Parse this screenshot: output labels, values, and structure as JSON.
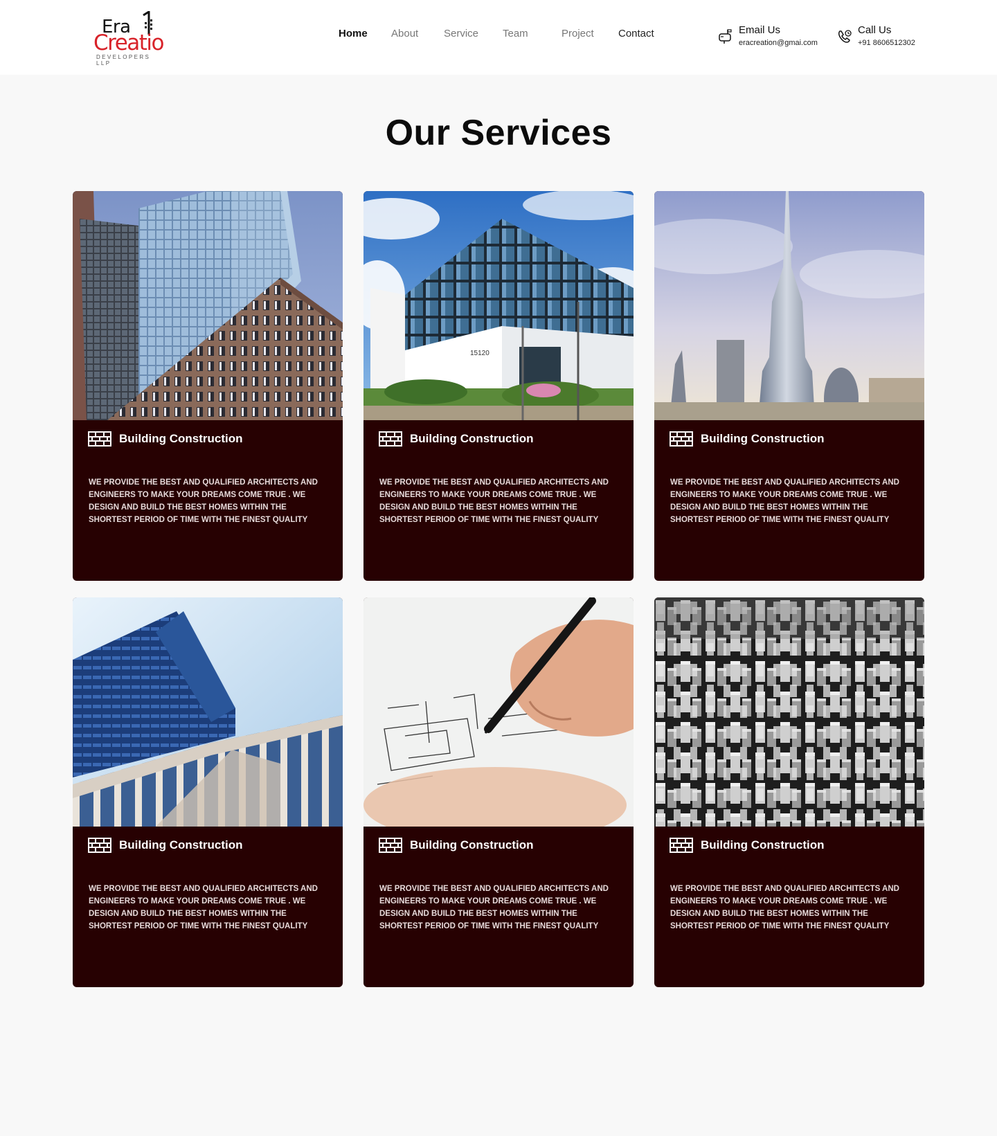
{
  "brand": {
    "line1": "Era",
    "line2": "Creatio",
    "tagline": "DEVELOPERS LLP",
    "accent_color": "#d8232a"
  },
  "nav": {
    "items": [
      {
        "label": "Home",
        "active": true
      },
      {
        "label": "About",
        "active": false
      },
      {
        "label": "Service",
        "active": false
      },
      {
        "label": "Team",
        "active": false
      },
      {
        "label": "Project",
        "active": false
      },
      {
        "label": "Contact",
        "active": false
      }
    ]
  },
  "contact": {
    "email": {
      "title": "Email Us",
      "value": "eracreation@gmai.com",
      "icon": "mailbox-icon"
    },
    "phone": {
      "title": "Call Us",
      "value": "+91 8606512302",
      "icon": "phone-icon"
    }
  },
  "services": {
    "heading": "Our Services",
    "card_color": "#270102",
    "cards": [
      {
        "image": "glass-skyscrapers-photo",
        "icon": "brick-wall-icon",
        "title": "Building Construction",
        "description": "WE PROVIDE THE BEST AND QUALIFIED ARCHITECTS AND ENGINEERS TO MAKE YOUR DREAMS COME TRUE . WE DESIGN AND BUILD THE BEST HOMES WITHIN THE SHORTEST PERIOD OF TIME WITH THE FINEST QUALITY"
      },
      {
        "image": "glass-office-building-photo",
        "icon": "brick-wall-icon",
        "title": "Building Construction",
        "description": "WE PROVIDE THE BEST AND QUALIFIED ARCHITECTS AND ENGINEERS TO MAKE YOUR DREAMS COME TRUE . WE DESIGN AND BUILD THE BEST HOMES WITHIN THE SHORTEST PERIOD OF TIME WITH THE FINEST QUALITY"
      },
      {
        "image": "tall-tower-photo",
        "icon": "brick-wall-icon",
        "title": "Building Construction",
        "description": "WE PROVIDE THE BEST AND QUALIFIED ARCHITECTS AND ENGINEERS TO MAKE YOUR DREAMS COME TRUE . WE DESIGN AND BUILD THE BEST HOMES WITHIN THE SHORTEST PERIOD OF TIME WITH THE FINEST QUALITY"
      },
      {
        "image": "modern-facade-photo",
        "icon": "brick-wall-icon",
        "title": "Building Construction",
        "description": "WE PROVIDE THE BEST AND QUALIFIED ARCHITECTS AND ENGINEERS TO MAKE YOUR DREAMS COME TRUE . WE DESIGN AND BUILD THE BEST HOMES WITHIN THE SHORTEST PERIOD OF TIME WITH THE FINEST QUALITY"
      },
      {
        "image": "architect-drawing-photo",
        "icon": "brick-wall-icon",
        "title": "Building Construction",
        "description": "WE PROVIDE THE BEST AND QUALIFIED ARCHITECTS AND ENGINEERS TO MAKE YOUR DREAMS COME TRUE . WE DESIGN AND BUILD THE BEST HOMES WITHIN THE SHORTEST PERIOD OF TIME WITH THE FINEST QUALITY"
      },
      {
        "image": "city-aerial-bw-photo",
        "icon": "brick-wall-icon",
        "title": "Building Construction",
        "description": "WE PROVIDE THE BEST AND QUALIFIED ARCHITECTS AND ENGINEERS TO MAKE YOUR DREAMS COME TRUE . WE DESIGN AND BUILD THE BEST HOMES WITHIN THE SHORTEST PERIOD OF TIME WITH THE FINEST QUALITY"
      }
    ]
  }
}
